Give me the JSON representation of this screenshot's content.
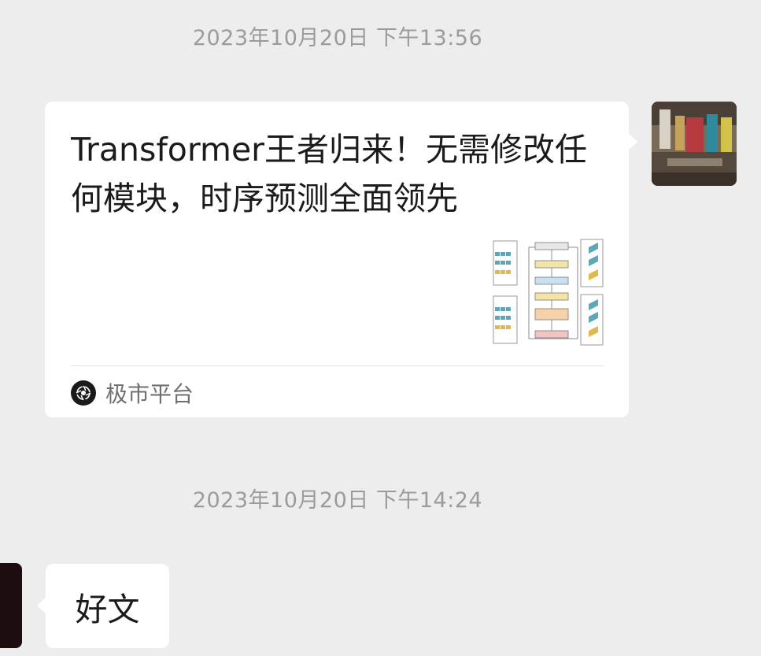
{
  "messages": [
    {
      "timestamp": "2023年10月20日 下午13:56",
      "sender": "self",
      "type": "article",
      "article": {
        "title": "Transformer王者归来！无需修改任何模块，时序预测全面领先",
        "thumbnail_icon": "transformer-architecture-diagram",
        "source": "极市平台",
        "source_icon": "jishi-platform-logo"
      }
    },
    {
      "timestamp": "2023年10月20日 下午14:24",
      "sender": "other",
      "type": "text",
      "text": "好文"
    }
  ],
  "colors": {
    "background": "#ededed",
    "bubble": "#ffffff",
    "timestamp_text": "#9b9b9b",
    "source_text": "#6f6f6f"
  }
}
